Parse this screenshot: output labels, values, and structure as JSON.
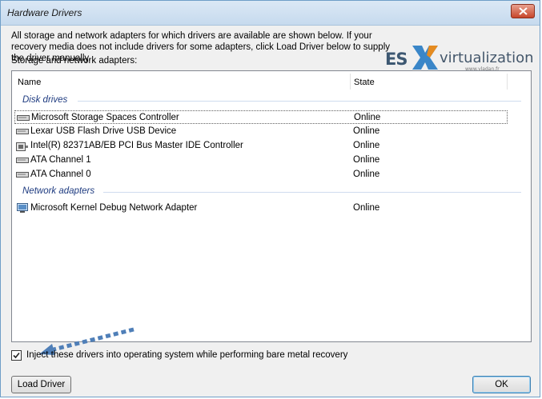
{
  "window": {
    "title": "Hardware Drivers",
    "description": "All storage and network adapters for which drivers are available are shown below. If your recovery media does not include drivers for some adapters, click Load Driver below to supply the driver manually.",
    "list_label": "Storage and network adapters:"
  },
  "logo": {
    "es": "ES",
    "virt": "virtualization",
    "url": "www.vladan.fr"
  },
  "columns": {
    "name": "Name",
    "state": "State"
  },
  "groups": {
    "disk": {
      "label": "Disk drives",
      "rows": [
        {
          "name": "Microsoft Storage Spaces Controller",
          "state": "Online"
        },
        {
          "name": "Lexar USB Flash Drive USB Device",
          "state": "Online"
        },
        {
          "name": "Intel(R) 82371AB/EB PCI Bus Master IDE Controller",
          "state": "Online"
        },
        {
          "name": "ATA Channel 1",
          "state": "Online"
        },
        {
          "name": "ATA Channel 0",
          "state": "Online"
        }
      ]
    },
    "network": {
      "label": "Network adapters",
      "rows": [
        {
          "name": "Microsoft Kernel Debug Network Adapter",
          "state": "Online"
        }
      ]
    }
  },
  "inject": {
    "label": "Inject these drivers into operating system while performing bare metal recovery",
    "checked": true
  },
  "buttons": {
    "load_driver": "Load Driver",
    "ok": "OK"
  },
  "colors": {
    "arrow": "#4f7fb8",
    "group_text": "#1e3b80",
    "title_bar": "#c6daee"
  }
}
